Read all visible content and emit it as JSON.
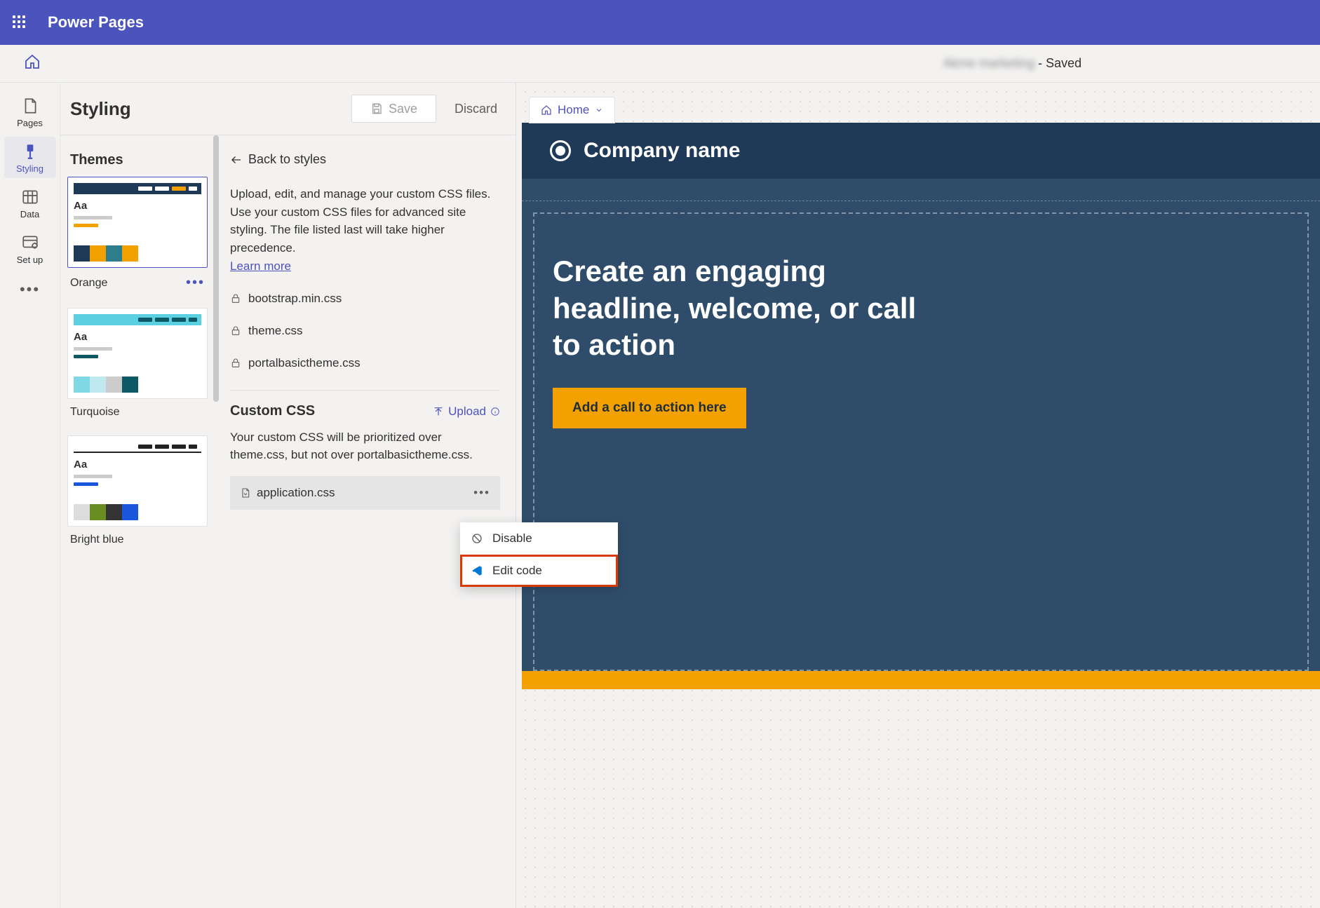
{
  "app": {
    "title": "Power Pages"
  },
  "subbar": {
    "site_name": "Akme marketing",
    "status_suffix": " - Saved"
  },
  "left_nav": {
    "items": [
      {
        "label": "Pages"
      },
      {
        "label": "Styling"
      },
      {
        "label": "Data"
      },
      {
        "label": "Set up"
      }
    ]
  },
  "themes": {
    "panel_title": "Styling",
    "section_title": "Themes",
    "list": [
      {
        "label": "Orange"
      },
      {
        "label": "Turquoise"
      },
      {
        "label": "Bright blue"
      }
    ]
  },
  "actions": {
    "save": "Save",
    "discard": "Discard"
  },
  "detail": {
    "back_label": "Back to styles",
    "description": "Upload, edit, and manage your custom CSS files. Use your custom CSS files for advanced site styling. The file listed last will take higher precedence.",
    "learn_more": "Learn more",
    "locked_files": [
      {
        "name": "bootstrap.min.css"
      },
      {
        "name": "theme.css"
      },
      {
        "name": "portalbasictheme.css"
      }
    ],
    "custom_header": "Custom CSS",
    "upload_label": "Upload",
    "custom_desc": "Your custom CSS will be prioritized over theme.css, but not over portalbasictheme.css.",
    "custom_file": "application.css"
  },
  "context_menu": {
    "disable": "Disable",
    "edit_code": "Edit code"
  },
  "breadcrumb": {
    "label": "Home"
  },
  "preview": {
    "company": "Company name",
    "headline": "Create an engaging headline, welcome, or call to action",
    "cta": "Add a call to action here"
  }
}
